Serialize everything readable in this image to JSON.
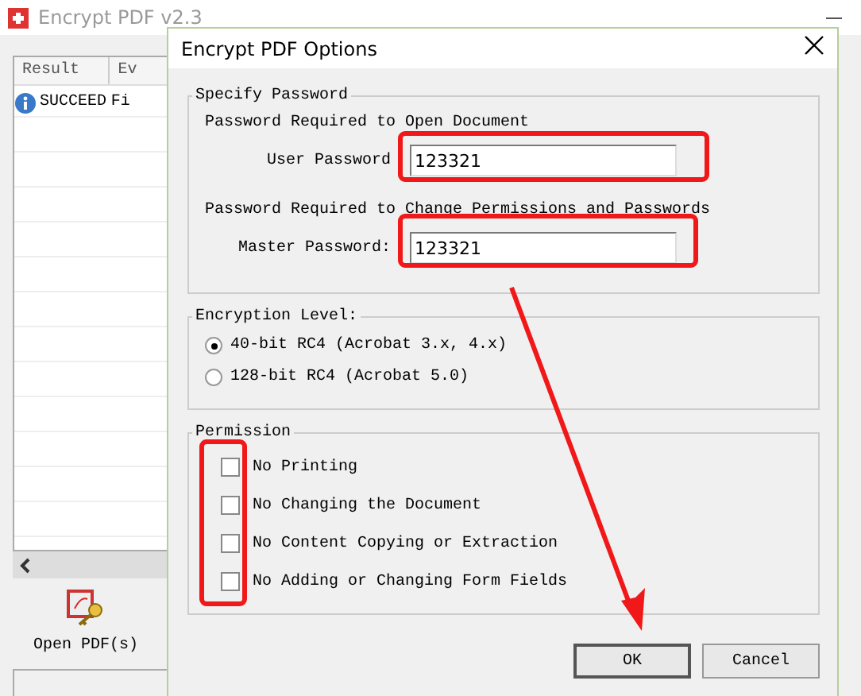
{
  "main_window": {
    "title": "Encrypt PDF v2.3",
    "table": {
      "columns": [
        "Result",
        "Ev"
      ],
      "rows": [
        {
          "cells": [
            "SUCCEED",
            "Fi"
          ]
        }
      ]
    },
    "open_button": "Open PDF(s)"
  },
  "dialog": {
    "title": "Encrypt PDF Options",
    "specify_password": {
      "title": "Specify Password",
      "open_heading": "Password Required to Open Document",
      "user_label": "User Password",
      "user_value": "123321",
      "master_heading": "Password Required to Change Permissions and Passwords",
      "master_label": "Master Password:",
      "master_value": "123321"
    },
    "encryption": {
      "title": "Encryption Level:",
      "options": [
        {
          "label": "40-bit RC4 (Acrobat 3.x, 4.x)",
          "selected": true
        },
        {
          "label": "128-bit RC4 (Acrobat 5.0)",
          "selected": false
        }
      ]
    },
    "permission": {
      "title": "Permission",
      "options": [
        {
          "label": "No Printing",
          "checked": false
        },
        {
          "label": "No Changing the Document",
          "checked": false
        },
        {
          "label": "No Content Copying or Extraction",
          "checked": false
        },
        {
          "label": "No Adding or Changing Form Fields",
          "checked": false
        }
      ]
    },
    "buttons": [
      {
        "label": "OK",
        "default": true
      },
      {
        "label": "Cancel",
        "default": false
      }
    ]
  }
}
